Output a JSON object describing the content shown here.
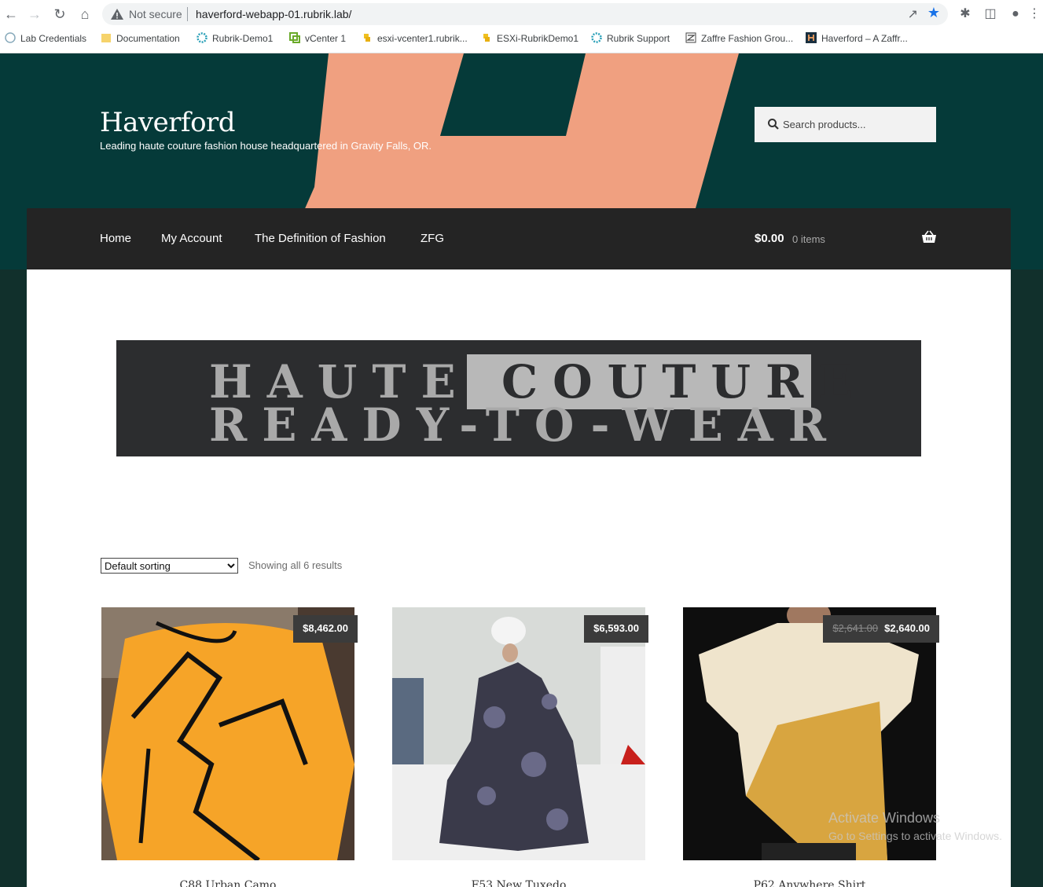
{
  "browser": {
    "security_label": "Not secure",
    "url": "haverford-webapp-01.rubrik.lab/",
    "bookmarks": [
      {
        "label": "Lab Credentials",
        "icon": "globe-icon"
      },
      {
        "label": "Documentation",
        "icon": "folder-icon"
      },
      {
        "label": "Rubrik-Demo1",
        "icon": "rubrik-icon"
      },
      {
        "label": "vCenter 1",
        "icon": "vcenter-icon"
      },
      {
        "label": "esxi-vcenter1.rubrik...",
        "icon": "python-icon"
      },
      {
        "label": "ESXi-RubrikDemo1",
        "icon": "python-icon"
      },
      {
        "label": "Rubrik Support",
        "icon": "rubrik-icon"
      },
      {
        "label": "Zaffre Fashion Grou...",
        "icon": "zfg-icon"
      },
      {
        "label": "Haverford – A Zaffr...",
        "icon": "haverford-icon"
      }
    ]
  },
  "site": {
    "title": "Haverford",
    "description": "Leading haute couture fashion house headquartered in Gravity Falls, OR.",
    "search_placeholder": "Search products..."
  },
  "nav": {
    "items": [
      "Home",
      "My Account",
      "The Definition of Fashion",
      "ZFG"
    ],
    "cart_amount": "$0.00",
    "cart_count": "0 items"
  },
  "banner": {
    "line1_a": "HAUTE",
    "line1_b": "COUTURE",
    "line2": "READY-TO-WEAR"
  },
  "shop": {
    "sorting_selected": "Default sorting",
    "result_count": "Showing all 6 results",
    "products": [
      {
        "title": "C88 Urban Camo",
        "price": "$8,462.00",
        "old_price": ""
      },
      {
        "title": "F53 New Tuxedo",
        "price": "$6,593.00",
        "old_price": ""
      },
      {
        "title": "P62 Anywhere Shirt",
        "price": "$2,640.00",
        "old_price": "$2,641.00"
      }
    ]
  },
  "os": {
    "watermark_title": "Activate Windows",
    "watermark_sub": "Go to Settings to activate Windows."
  },
  "colors": {
    "header_bg": "#053a39",
    "nav_bg": "#242424",
    "accent_shape": "#f0a080",
    "page_bg": "#11302c"
  }
}
